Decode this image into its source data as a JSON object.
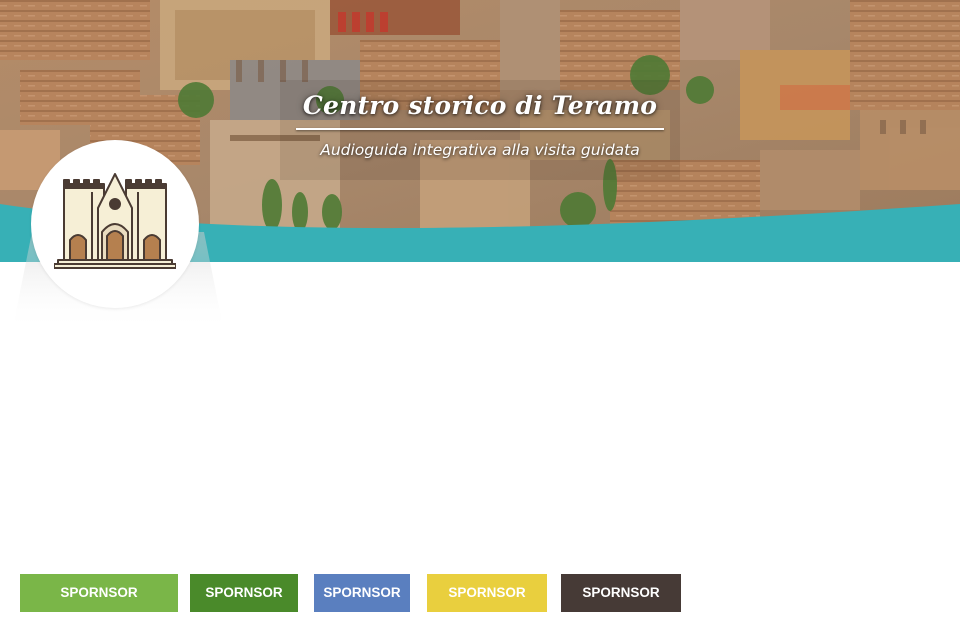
{
  "header": {
    "title": "Centro storico di Teramo",
    "subtitle": "Audioguida integrativa alla visita guidata",
    "accent_color": "#37b0b6"
  },
  "logo": {
    "icon": "cathedral-facade-icon"
  },
  "sponsors": [
    {
      "label": "SPORNSOR",
      "color": "#7ab648"
    },
    {
      "label": "SPORNSOR",
      "color": "#4a8a2a"
    },
    {
      "label": "SPORNSOR",
      "color": "#5a7fbf"
    },
    {
      "label": "SPORNSOR",
      "color": "#e9cf3e"
    },
    {
      "label": "SPORNSOR",
      "color": "#463a36"
    }
  ]
}
